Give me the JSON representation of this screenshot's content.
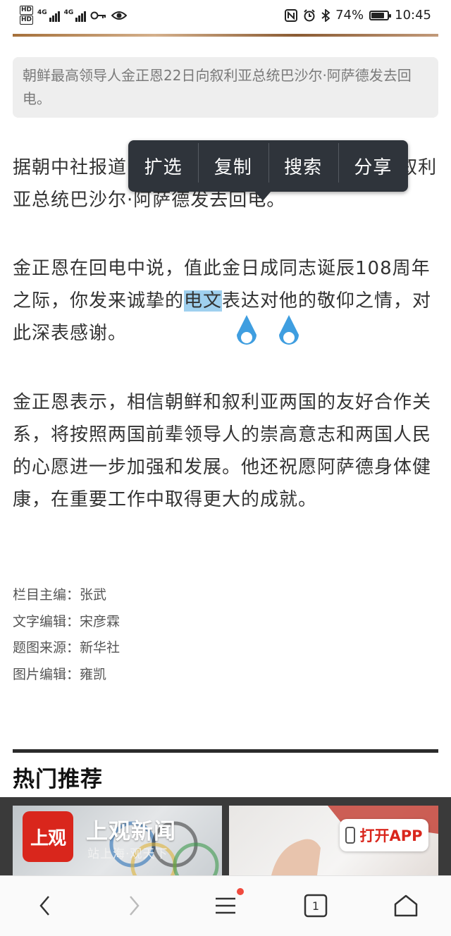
{
  "status_bar": {
    "hd1": "HD",
    "hd2": "HD",
    "net1": "4G",
    "net2": "4G",
    "battery_pct": "74%",
    "time": "10:45",
    "icons": [
      "hd-icon",
      "signal-icon",
      "key-icon",
      "eye-icon",
      "nfc-icon",
      "alarm-icon",
      "bluetooth-icon",
      "battery-icon"
    ]
  },
  "article": {
    "caption": "朝鲜最高领导人金正恩22日向叙利亚总统巴沙尔·阿萨德发去回电。",
    "p1_a": "据朝中社报道，朝鲜最高领导人金正恩22日向叙利亚总统巴沙尔·阿萨德发去回电。",
    "p2_before": "金正恩在回电中说，值此金日成同志诞辰108周年之际，你发来诚挚的",
    "p2_selected": "电文",
    "p2_after": "表达对他的敬仰之情，对此深表感谢。",
    "p3": "金正恩表示，相信朝鲜和叙利亚两国的友好合作关系，将按照两国前辈领导人的崇高意志和两国人民的心愿进一步加强和发展。他还祝愿阿萨德身体健康，在重要工作中取得更大的成就。"
  },
  "selection_menu": {
    "expand": "扩选",
    "copy": "复制",
    "search": "搜索",
    "share": "分享"
  },
  "credits": [
    "栏目主编：张武",
    "文字编辑：宋彦霖",
    "题图来源：新华社",
    "图片编辑：雍凯"
  ],
  "hot_section": {
    "title": "热门推荐"
  },
  "app_banner": {
    "logo_text": "上观",
    "brand": "上观新闻",
    "slogan": "站上海·观天下",
    "open_app": "打开APP",
    "brand_color": "#d9261c"
  },
  "bottom_nav": {
    "tab_count": "1",
    "icons": [
      "back-icon",
      "forward-icon",
      "menu-icon",
      "tabs-icon",
      "home-icon"
    ]
  }
}
